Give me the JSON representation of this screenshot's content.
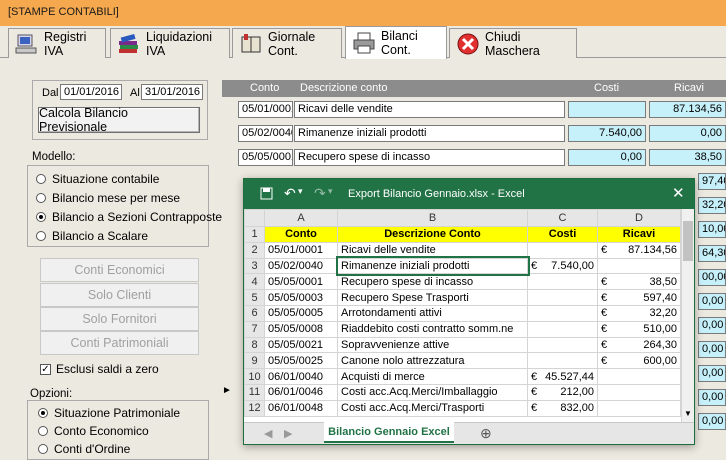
{
  "window": {
    "title": "[STAMPE CONTABILI]"
  },
  "tabs": [
    {
      "label": "Registri IVA",
      "icon": "register-computer-icon"
    },
    {
      "label": "Liquidazioni IVA",
      "icon": "books-icon"
    },
    {
      "label": "Giornale Cont.",
      "icon": "ledger-icon"
    },
    {
      "label": "Bilanci Cont.",
      "icon": "printer-icon"
    },
    {
      "label": "Chiudi Maschera",
      "icon": "close-red-icon"
    }
  ],
  "dates": {
    "from_label": "Dal",
    "from_value": "01/01/2016",
    "to_label": "Al",
    "to_value": "31/01/2016"
  },
  "calc_button": "Calcola Bilancio Previsionale",
  "modello": {
    "label": "Modello:",
    "options": [
      "Situazione contabile",
      "Bilancio mese per mese",
      "Bilancio a Sezioni Contrapposte",
      "Bilancio a Scalare"
    ],
    "selected_index": 2
  },
  "disabled_buttons": [
    "Conti Economici",
    "Solo Clienti",
    "Solo Fornitori",
    "Conti Patrimoniali"
  ],
  "esclusi": {
    "label": "Esclusi saldi a zero",
    "checked": true
  },
  "opzioni": {
    "label": "Opzioni:",
    "options": [
      "Situazione Patrimoniale",
      "Conto Economico",
      "Conti d'Ordine"
    ],
    "selected_index": 0
  },
  "grid": {
    "headers": {
      "conto": "Conto",
      "descrizione": "Descrizione conto",
      "costi": "Costi",
      "ricavi": "Ricavi"
    },
    "rows": [
      {
        "conto": "05/01/0001",
        "descrizione": "Ricavi delle vendite",
        "costi": "",
        "ricavi": "87.134,56"
      },
      {
        "conto": "05/02/0040",
        "descrizione": "Rimanenze iniziali prodotti",
        "costi": "7.540,00",
        "ricavi": "0,00"
      },
      {
        "conto": "05/05/0001",
        "descrizione": "Recupero spese di incasso",
        "costi": "0,00",
        "ricavi": "38,50"
      }
    ],
    "partial_right_values": [
      "97,40",
      "32,20",
      "10,00",
      "64,30",
      "00,00",
      "0,00",
      "0,00",
      "0,00",
      "0,00",
      "0,00",
      "0,00"
    ]
  },
  "excel": {
    "title": "Export Bilancio Gennaio.xlsx  -  Excel",
    "columns": [
      "A",
      "B",
      "C",
      "D"
    ],
    "header_row": [
      "Conto",
      "Descrizione Conto",
      "Costi",
      "Ricavi"
    ],
    "rows": [
      {
        "n": "2",
        "a": "05/01/0001",
        "b": "Ricavi delle vendite",
        "c_sym": "",
        "c": "",
        "d_sym": "€",
        "d": "87.134,56"
      },
      {
        "n": "3",
        "a": "05/02/0040",
        "b": "Rimanenze iniziali prodotti",
        "c_sym": "€",
        "c": "7.540,00",
        "d_sym": "",
        "d": ""
      },
      {
        "n": "4",
        "a": "05/05/0001",
        "b": "Recupero spese di incasso",
        "c_sym": "",
        "c": "",
        "d_sym": "€",
        "d": "38,50"
      },
      {
        "n": "5",
        "a": "05/05/0003",
        "b": "Recupero Spese Trasporti",
        "c_sym": "",
        "c": "",
        "d_sym": "€",
        "d": "597,40"
      },
      {
        "n": "6",
        "a": "05/05/0005",
        "b": "Arrotondamenti attivi",
        "c_sym": "",
        "c": "",
        "d_sym": "€",
        "d": "32,20"
      },
      {
        "n": "7",
        "a": "05/05/0008",
        "b": "Riaddebito costi contratto somm.ne",
        "c_sym": "",
        "c": "",
        "d_sym": "€",
        "d": "510,00"
      },
      {
        "n": "8",
        "a": "05/05/0021",
        "b": "Sopravvenienze attive",
        "c_sym": "",
        "c": "",
        "d_sym": "€",
        "d": "264,30"
      },
      {
        "n": "9",
        "a": "05/05/0025",
        "b": "Canone nolo attrezzatura",
        "c_sym": "",
        "c": "",
        "d_sym": "€",
        "d": "600,00"
      },
      {
        "n": "10",
        "a": "06/01/0040",
        "b": "Acquisti di merce",
        "c_sym": "€",
        "c": "45.527,44",
        "d_sym": "",
        "d": ""
      },
      {
        "n": "11",
        "a": "06/01/0046",
        "b": "Costi acc.Acq.Merci/Imballaggio",
        "c_sym": "€",
        "c": "212,00",
        "d_sym": "",
        "d": ""
      },
      {
        "n": "12",
        "a": "06/01/0048",
        "b": "Costi acc.Acq.Merci/Trasporti",
        "c_sym": "€",
        "c": "832,00",
        "d_sym": "",
        "d": ""
      }
    ],
    "sheet_tab": "Bilancio Gennaio Excel",
    "colors": {
      "header_bar": "#217346",
      "header_fill": "#ffff00"
    }
  },
  "colors": {
    "titlebar": "#f5a84e",
    "grid_header": "#8c8c8c",
    "value_cell": "#c7f1fa"
  }
}
